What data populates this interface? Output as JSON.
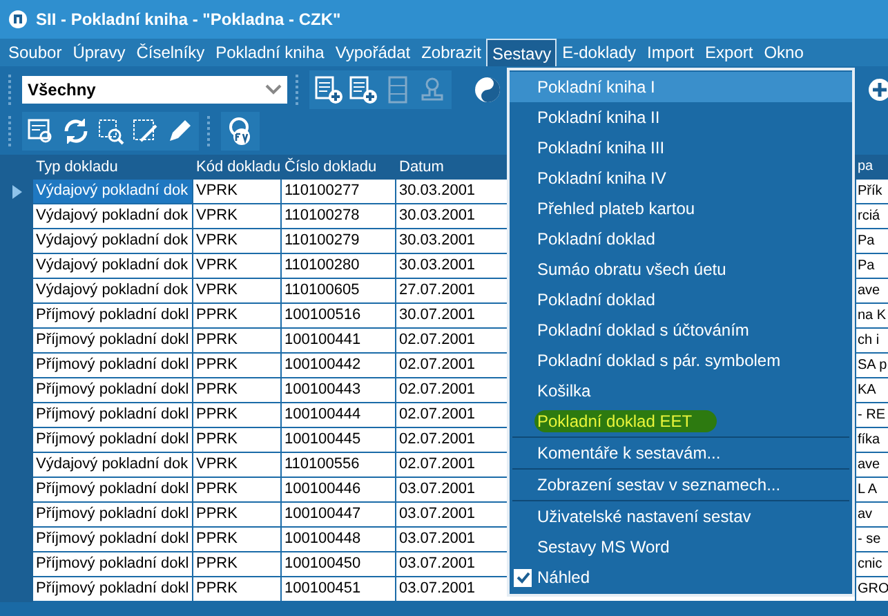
{
  "window": {
    "title": "SII - Pokladní kniha - \"Pokladna - CZK\""
  },
  "menu_bar": [
    {
      "label": "Soubor",
      "selected": false
    },
    {
      "label": "Úpravy",
      "selected": false
    },
    {
      "label": "Číselníky",
      "selected": false
    },
    {
      "label": "Pokladní kniha",
      "selected": false
    },
    {
      "label": "Vypořádat",
      "selected": false
    },
    {
      "label": "Zobrazit",
      "selected": false
    },
    {
      "label": "Sestavy",
      "selected": true
    },
    {
      "label": "E-doklady",
      "selected": false
    },
    {
      "label": "Import",
      "selected": false
    },
    {
      "label": "Export",
      "selected": false
    },
    {
      "label": "Okno",
      "selected": false
    }
  ],
  "filter": {
    "value": "Všechny"
  },
  "table": {
    "columns": [
      "Typ dokladu",
      "Kód dokladu",
      "Číslo dokladu",
      "Datum",
      "pa"
    ],
    "rows": [
      {
        "type": "Výdajový pokladní dok",
        "code": "VPRK",
        "number": "110100277",
        "date": "30.03.2001",
        "column_5": "Přík",
        "selected": true
      },
      {
        "type": "Výdajový pokladní dok",
        "code": "VPRK",
        "number": "110100278",
        "date": "30.03.2001",
        "column_5": "rciá",
        "selected": false
      },
      {
        "type": "Výdajový pokladní dok",
        "code": "VPRK",
        "number": "110100279",
        "date": "30.03.2001",
        "column_5": "Pa",
        "selected": false
      },
      {
        "type": "Výdajový pokladní dok",
        "code": "VPRK",
        "number": "110100280",
        "date": "30.03.2001",
        "column_5": "Pa",
        "selected": false
      },
      {
        "type": "Výdajový pokladní dok",
        "code": "VPRK",
        "number": "110100605",
        "date": "27.07.2001",
        "column_5": "ave",
        "selected": false
      },
      {
        "type": "Příjmový pokladní dokl",
        "code": "PPRK",
        "number": "100100516",
        "date": "30.07.2001",
        "column_5": "na K",
        "selected": false
      },
      {
        "type": "Příjmový pokladní dokl",
        "code": "PPRK",
        "number": "100100441",
        "date": "02.07.2001",
        "column_5": "ch i",
        "selected": false
      },
      {
        "type": "Příjmový pokladní dokl",
        "code": "PPRK",
        "number": "100100442",
        "date": "02.07.2001",
        "column_5": "SA p",
        "selected": false
      },
      {
        "type": "Příjmový pokladní dokl",
        "code": "PPRK",
        "number": "100100443",
        "date": "02.07.2001",
        "column_5": "KA",
        "selected": false
      },
      {
        "type": "Příjmový pokladní dokl",
        "code": "PPRK",
        "number": "100100444",
        "date": "02.07.2001",
        "column_5": "- RE",
        "selected": false
      },
      {
        "type": "Příjmový pokladní dokl",
        "code": "PPRK",
        "number": "100100445",
        "date": "02.07.2001",
        "column_5": "fíka",
        "selected": false
      },
      {
        "type": "Výdajový pokladní dok",
        "code": "VPRK",
        "number": "110100556",
        "date": "02.07.2001",
        "column_5": "ave",
        "selected": false
      },
      {
        "type": "Příjmový pokladní dokl",
        "code": "PPRK",
        "number": "100100446",
        "date": "03.07.2001",
        "column_5": "L A",
        "selected": false
      },
      {
        "type": "Příjmový pokladní dokl",
        "code": "PPRK",
        "number": "100100447",
        "date": "03.07.2001",
        "column_5": "av",
        "selected": false
      },
      {
        "type": "Příjmový pokladní dokl",
        "code": "PPRK",
        "number": "100100448",
        "date": "03.07.2001",
        "column_5": "- se",
        "selected": false
      },
      {
        "type": "Příjmový pokladní dokl",
        "code": "PPRK",
        "number": "100100450",
        "date": "03.07.2001",
        "column_5": "cnic",
        "selected": false
      },
      {
        "type": "Příjmový pokladní dokl",
        "code": "PPRK",
        "number": "100100451",
        "date": "03.07.2001",
        "column_5": "GRO",
        "selected": false
      }
    ]
  },
  "dropdown_menu": [
    {
      "kind": "item",
      "label": "Pokladní kniha I",
      "selected": true,
      "marked": false,
      "separator_after": false
    },
    {
      "kind": "item",
      "label": "Pokladní kniha II",
      "selected": false,
      "marked": false,
      "separator_after": false
    },
    {
      "kind": "item",
      "label": "Pokladní kniha III",
      "selected": false,
      "marked": false,
      "separator_after": false
    },
    {
      "kind": "item",
      "label": "Pokladní kniha IV",
      "selected": false,
      "marked": false,
      "separator_after": false
    },
    {
      "kind": "item",
      "label": "Přehled plateb kartou",
      "selected": false,
      "marked": false,
      "separator_after": false
    },
    {
      "kind": "item",
      "label": "Pokladní doklad",
      "selected": false,
      "marked": false,
      "separator_after": false
    },
    {
      "kind": "item",
      "label": "Sumáo obratu všech úetu",
      "selected": false,
      "marked": false,
      "separator_after": false
    },
    {
      "kind": "item",
      "label": "Pokladní doklad",
      "selected": false,
      "marked": false,
      "separator_after": false
    },
    {
      "kind": "item",
      "label": "Pokladní doklad s účtováním",
      "selected": false,
      "marked": false,
      "separator_after": false
    },
    {
      "kind": "item",
      "label": "Pokladní doklad s pár. symbolem",
      "selected": false,
      "marked": false,
      "separator_after": false
    },
    {
      "kind": "item",
      "label": "Košilka",
      "selected": false,
      "marked": false,
      "separator_after": false
    },
    {
      "kind": "item",
      "label": "Pokladní doklad EET",
      "selected": false,
      "marked": true,
      "separator_after": true
    },
    {
      "kind": "item",
      "label": "Komentáře k sestavám...",
      "selected": false,
      "marked": false,
      "separator_after": true
    },
    {
      "kind": "item",
      "label": "Zobrazení sestav v seznamech...",
      "selected": false,
      "marked": false,
      "separator_after": true
    },
    {
      "kind": "item",
      "label": "Uživatelské nastavení sestav",
      "selected": false,
      "marked": false,
      "separator_after": false
    },
    {
      "kind": "item",
      "label": "Sestavy MS Word",
      "selected": false,
      "marked": false,
      "separator_after": false
    },
    {
      "kind": "check",
      "label": "Náhled",
      "checked": true,
      "selected": false,
      "marked": false,
      "separator_after": false
    }
  ]
}
